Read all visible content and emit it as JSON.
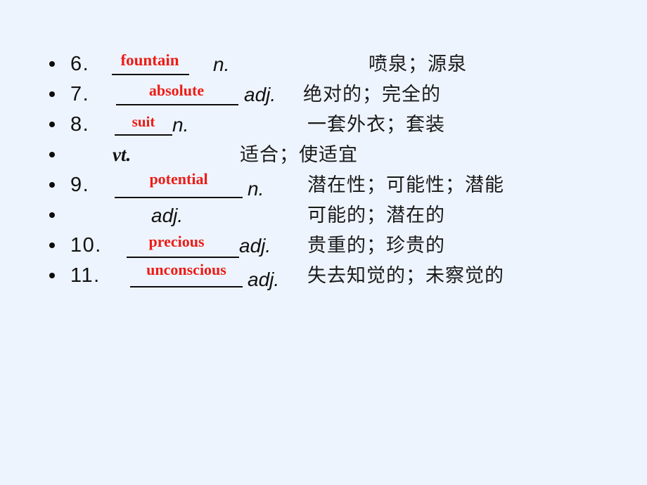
{
  "slide": {
    "background_color": "#eef4fd",
    "answer_color": "#ed1c16",
    "text_color": "#111111",
    "bullet_glyph": "•"
  },
  "entries": [
    {
      "number": "6.",
      "answer": "fountain",
      "pos": "n.",
      "chinese": "喷泉；源泉"
    },
    {
      "number": "7.",
      "answer": "absolute",
      "pos": "adj.",
      "chinese": "绝对的；完全的"
    },
    {
      "number": "8.",
      "answer": "suit",
      "pos": "n.",
      "chinese": "一套外衣；套装"
    },
    {
      "number": "",
      "answer": "",
      "pos": "vt.",
      "chinese": "适合；使适宜"
    },
    {
      "number": "9.",
      "answer": "potential",
      "pos": "n.",
      "chinese": "潜在性；可能性；潜能"
    },
    {
      "number": "",
      "answer": "",
      "pos": "adj.",
      "chinese": "可能的；潜在的"
    },
    {
      "number": "10.",
      "answer": "precious",
      "pos": "adj.",
      "chinese": "贵重的；珍贵的"
    },
    {
      "number": "11.",
      "answer": "unconscious",
      "pos": "adj.",
      "chinese": "失去知觉的；未察觉的"
    }
  ]
}
